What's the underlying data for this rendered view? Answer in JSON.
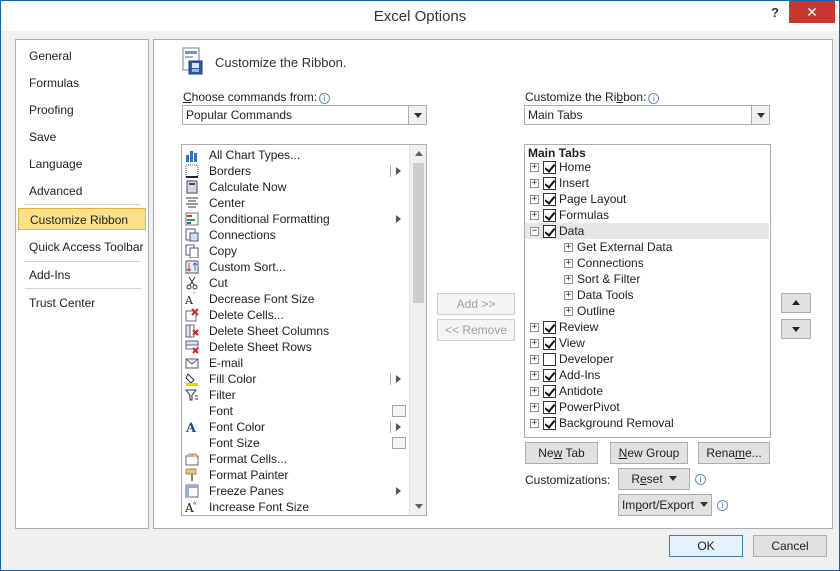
{
  "window": {
    "title": "Excel Options",
    "help_label": "?",
    "close_label": "✕"
  },
  "nav": {
    "items": [
      {
        "label": "General",
        "active": false
      },
      {
        "label": "Formulas",
        "active": false
      },
      {
        "label": "Proofing",
        "active": false
      },
      {
        "label": "Save",
        "active": false
      },
      {
        "label": "Language",
        "active": false
      },
      {
        "label": "Advanced",
        "active": false
      },
      {
        "label": "Customize Ribbon",
        "active": true
      },
      {
        "label": "Quick Access Toolbar",
        "active": false
      },
      {
        "label": "Add-Ins",
        "active": false
      },
      {
        "label": "Trust Center",
        "active": false
      }
    ]
  },
  "main": {
    "heading": "Customize the Ribbon.",
    "choose_label_pre": "C",
    "choose_label_post": "hoose commands from:",
    "choose_value": "Popular Commands",
    "customize_label_pre": "Customize the Ri",
    "customize_label_u": "b",
    "customize_label_post": "bon:",
    "customize_value": "Main Tabs",
    "commands": [
      {
        "label": "All Chart Types...",
        "icon": "chart-icon",
        "sub": ""
      },
      {
        "label": "Borders",
        "icon": "borders-icon",
        "sub": "pipe-arrow"
      },
      {
        "label": "Calculate Now",
        "icon": "calculator-icon",
        "sub": ""
      },
      {
        "label": "Center",
        "icon": "align-center-icon",
        "sub": ""
      },
      {
        "label": "Conditional Formatting",
        "icon": "conditional-formatting-icon",
        "sub": "arrow"
      },
      {
        "label": "Connections",
        "icon": "connections-icon",
        "sub": ""
      },
      {
        "label": "Copy",
        "icon": "copy-icon",
        "sub": ""
      },
      {
        "label": "Custom Sort...",
        "icon": "sort-icon",
        "sub": ""
      },
      {
        "label": "Cut",
        "icon": "scissors-icon",
        "sub": ""
      },
      {
        "label": "Decrease Font Size",
        "icon": "decrease-font-icon",
        "sub": ""
      },
      {
        "label": "Delete Cells...",
        "icon": "delete-cells-icon",
        "sub": ""
      },
      {
        "label": "Delete Sheet Columns",
        "icon": "delete-columns-icon",
        "sub": ""
      },
      {
        "label": "Delete Sheet Rows",
        "icon": "delete-rows-icon",
        "sub": ""
      },
      {
        "label": "E-mail",
        "icon": "email-icon",
        "sub": ""
      },
      {
        "label": "Fill Color",
        "icon": "fill-color-icon",
        "sub": "pipe-arrow"
      },
      {
        "label": "Filter",
        "icon": "filter-icon",
        "sub": ""
      },
      {
        "label": "Font",
        "icon": "",
        "sub": "box"
      },
      {
        "label": "Font Color",
        "icon": "font-color-icon",
        "sub": "pipe-arrow"
      },
      {
        "label": "Font Size",
        "icon": "",
        "sub": "box"
      },
      {
        "label": "Format Cells...",
        "icon": "format-cells-icon",
        "sub": ""
      },
      {
        "label": "Format Painter",
        "icon": "format-painter-icon",
        "sub": ""
      },
      {
        "label": "Freeze Panes",
        "icon": "freeze-panes-icon",
        "sub": "arrow"
      },
      {
        "label": "Increase Font Size",
        "icon": "increase-font-icon",
        "sub": ""
      }
    ],
    "add_label": "Add >>",
    "remove_label": "<< Remove",
    "tree_header": "Main Tabs",
    "tree": [
      {
        "label": "Home",
        "level": 0,
        "checked": true,
        "expander": "+",
        "selected": false
      },
      {
        "label": "Insert",
        "level": 0,
        "checked": true,
        "expander": "+",
        "selected": false
      },
      {
        "label": "Page Layout",
        "level": 0,
        "checked": true,
        "expander": "+",
        "selected": false
      },
      {
        "label": "Formulas",
        "level": 0,
        "checked": true,
        "expander": "+",
        "selected": false
      },
      {
        "label": "Data",
        "level": 0,
        "checked": true,
        "expander": "−",
        "selected": true
      },
      {
        "label": "Get External Data",
        "level": 1,
        "checked": false,
        "expander": "+",
        "selected": false
      },
      {
        "label": "Connections",
        "level": 1,
        "checked": false,
        "expander": "+",
        "selected": false
      },
      {
        "label": "Sort & Filter",
        "level": 1,
        "checked": false,
        "expander": "+",
        "selected": false
      },
      {
        "label": "Data Tools",
        "level": 1,
        "checked": false,
        "expander": "+",
        "selected": false
      },
      {
        "label": "Outline",
        "level": 1,
        "checked": false,
        "expander": "+",
        "selected": false
      },
      {
        "label": "Review",
        "level": 0,
        "checked": true,
        "expander": "+",
        "selected": false
      },
      {
        "label": "View",
        "level": 0,
        "checked": true,
        "expander": "+",
        "selected": false
      },
      {
        "label": "Developer",
        "level": 0,
        "checked": false,
        "expander": "+",
        "selected": false
      },
      {
        "label": "Add-Ins",
        "level": 0,
        "checked": true,
        "expander": "+",
        "selected": false
      },
      {
        "label": "Antidote",
        "level": 0,
        "checked": true,
        "expander": "+",
        "selected": false
      },
      {
        "label": "PowerPivot",
        "level": 0,
        "checked": true,
        "expander": "+",
        "selected": false
      },
      {
        "label": "Background Removal",
        "level": 0,
        "checked": true,
        "expander": "+",
        "selected": false
      }
    ],
    "new_tab_pre": "Ne",
    "new_tab_u": "w",
    "new_tab_post": " Tab",
    "new_group_pre": "",
    "new_group_u": "N",
    "new_group_post": "ew Group",
    "rename_pre": "Rena",
    "rename_u": "m",
    "rename_post": "e...",
    "customizations_label": "Customizations:",
    "reset_pre": "R",
    "reset_u": "e",
    "reset_post": "set",
    "import_export_pre": "Im",
    "import_export_u": "p",
    "import_export_post": "ort/Export"
  },
  "footer": {
    "ok_label": "OK",
    "cancel_label": "Cancel"
  },
  "colors": {
    "accent": "#fbe08a",
    "close": "#c7372f",
    "border": "#abadb3"
  }
}
